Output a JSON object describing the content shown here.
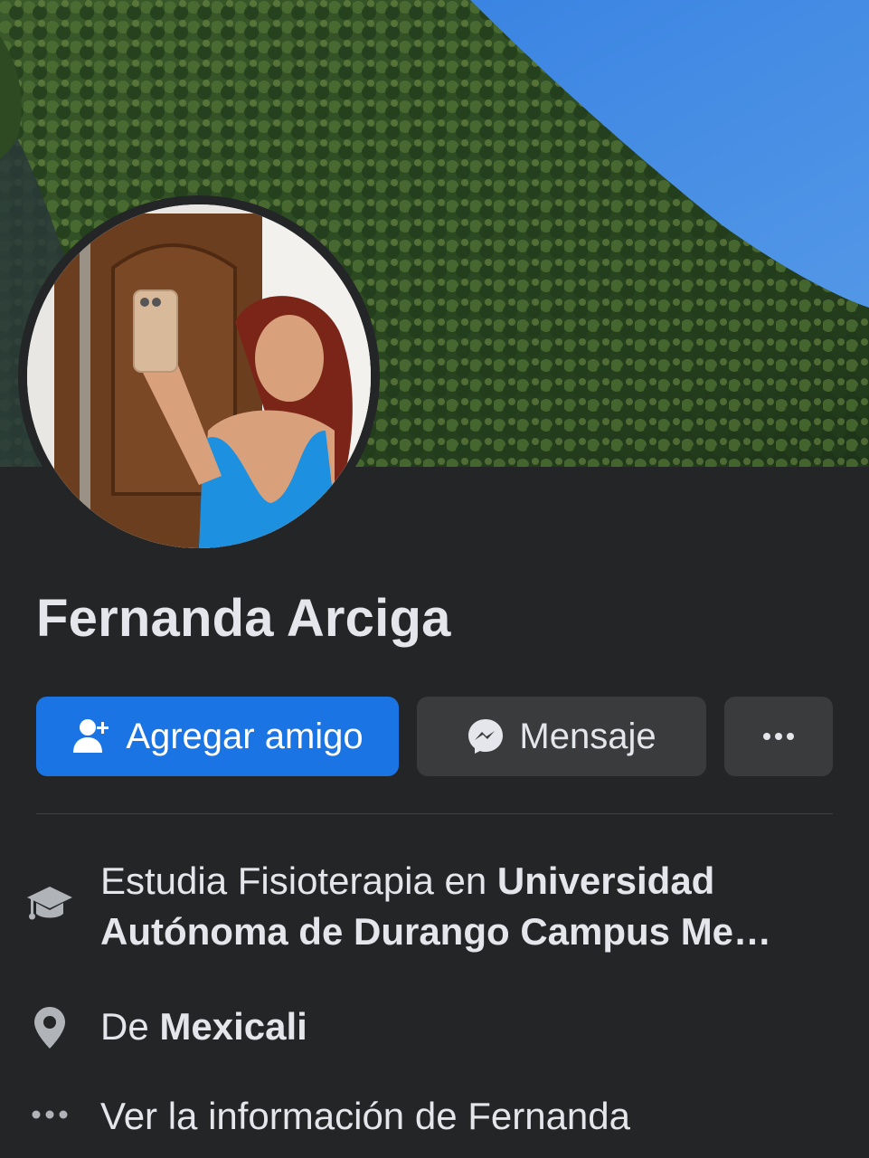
{
  "profile": {
    "name": "Fernanda Arciga"
  },
  "actions": {
    "add_friend_label": "Agregar amigo",
    "message_label": "Mensaje"
  },
  "info": {
    "education_prefix": "Estudia Fisioterapia en ",
    "education_school_line1": "Universidad",
    "education_school_line2": "Autónoma de Durango Campus Me…",
    "location_prefix": "De ",
    "location_city": "Mexicali",
    "see_info_label": "Ver la información de Fernanda"
  },
  "icons": {
    "add_friend": "person-plus-icon",
    "message": "messenger-icon",
    "more": "ellipsis-icon",
    "education": "graduation-cap-icon",
    "location": "map-pin-icon",
    "see_info": "ellipsis-icon"
  },
  "colors": {
    "background": "#242526",
    "primary_button": "#1b74e4",
    "secondary_button": "#3a3b3c",
    "text_primary": "#e4e6eb",
    "icon_gray": "#b0b3b8"
  }
}
